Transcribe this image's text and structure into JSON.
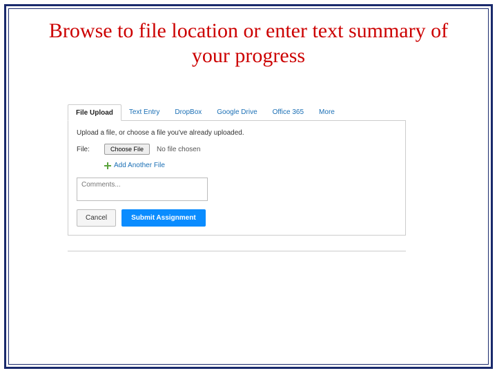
{
  "title": "Browse to file location or enter text summary of your progress",
  "tabs": {
    "t0": "File Upload",
    "t1": "Text Entry",
    "t2": "DropBox",
    "t3": "Google Drive",
    "t4": "Office 365",
    "t5": "More"
  },
  "instruction": "Upload a file, or choose a file you've already uploaded.",
  "file_label": "File:",
  "choose_file_label": "Choose File",
  "no_file_text": "No file chosen",
  "add_another_label": "Add Another File",
  "comments_placeholder": "Comments...",
  "cancel_label": "Cancel",
  "submit_label": "Submit Assignment"
}
